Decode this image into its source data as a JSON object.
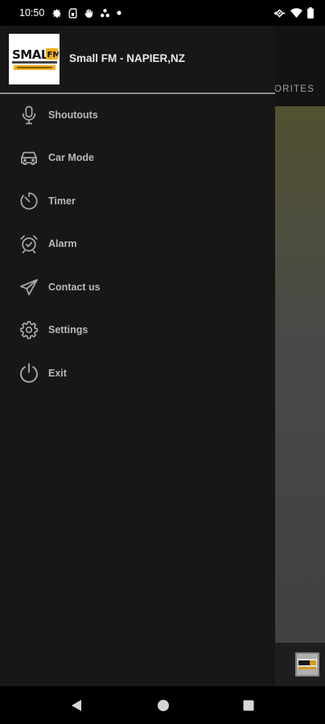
{
  "status_bar": {
    "time": "10:50",
    "left_icons": [
      "settings-icon",
      "sim-card-icon",
      "hand-icon",
      "apps-dots-icon",
      "notification-dot-icon"
    ],
    "right_icons": [
      "vpn-key-icon",
      "wifi-icon",
      "battery-icon"
    ]
  },
  "drawer": {
    "station_name": "Small FM - NAPIER,NZ",
    "logo_text": "SMALL FM",
    "items": [
      {
        "label": "Shoutouts",
        "icon": "microphone-icon"
      },
      {
        "label": "Car Mode",
        "icon": "car-icon"
      },
      {
        "label": "Timer",
        "icon": "timer-icon"
      },
      {
        "label": "Alarm",
        "icon": "alarm-clock-icon"
      },
      {
        "label": "Contact us",
        "icon": "send-icon"
      },
      {
        "label": "Settings",
        "icon": "gear-icon"
      },
      {
        "label": "Exit",
        "icon": "power-icon"
      }
    ]
  },
  "background": {
    "tab_label_partial": "ORITES"
  },
  "nav_bar": {
    "buttons": [
      "back-icon",
      "home-icon",
      "recents-icon"
    ]
  },
  "colors": {
    "drawer_bg": "#171717",
    "label": "#b9b9b9",
    "icon": "#a8a8a8",
    "divider": "#8d8d8d",
    "logo_accent": "#f2b01e"
  }
}
